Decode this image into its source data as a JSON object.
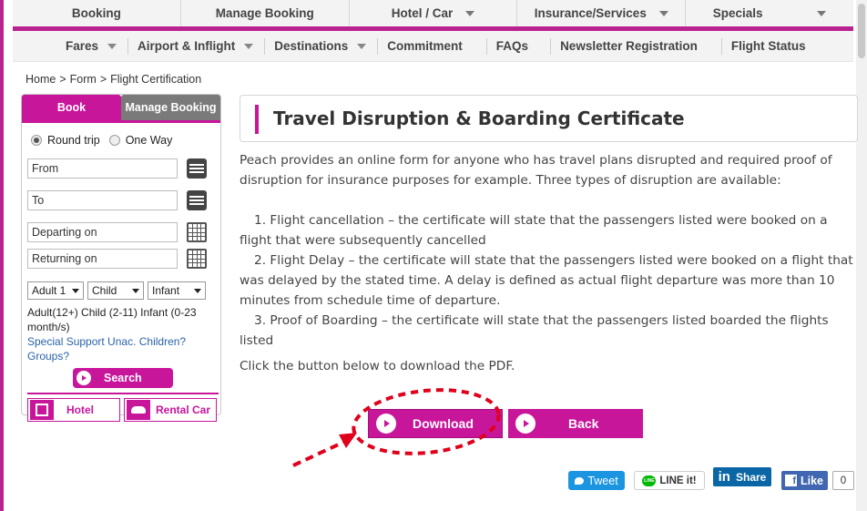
{
  "topnav": [
    {
      "label": "Booking",
      "dropdown": false
    },
    {
      "label": "Manage Booking",
      "dropdown": false
    },
    {
      "label": "Hotel / Car",
      "dropdown": true
    },
    {
      "label": "Insurance/Services",
      "dropdown": true
    },
    {
      "label": "Specials",
      "dropdown": true
    }
  ],
  "subnav": [
    {
      "label": "Fares",
      "dropdown": true
    },
    {
      "label": "Airport & Inflight",
      "dropdown": true
    },
    {
      "label": "Destinations",
      "dropdown": true
    },
    {
      "label": "Commitment",
      "dropdown": false
    },
    {
      "label": "FAQs",
      "dropdown": false
    },
    {
      "label": "Newsletter Registration",
      "dropdown": false
    },
    {
      "label": "Flight Status",
      "dropdown": false
    }
  ],
  "breadcrumb": [
    "Home",
    ">",
    "Form",
    ">",
    "Flight Certification"
  ],
  "widget": {
    "tab_book": "Book",
    "tab_manage": "Manage Booking",
    "round_trip": "Round trip",
    "one_way": "One Way",
    "from_value": "From",
    "to_value": "To",
    "departing_value": "Departing on",
    "returning_value": "Returning on",
    "adult_select": "Adult 1",
    "child_select": "Child",
    "infant_select": "Infant",
    "pax_note": "Adult(12+) Child (2-11) Infant (0-23 month/s)",
    "link_unac": "Special Support Unac. Children?",
    "link_groups": "Groups?",
    "search_label": "Search",
    "hotel_label": "Hotel",
    "car_label": "Rental Car"
  },
  "main": {
    "title": "Travel Disruption & Boarding Certificate",
    "intro": "Peach provides an online form for anyone who has travel plans disrupted and required proof of disruption for insurance purposes for example. Three types of disruption are available:",
    "items": [
      "1. Flight cancellation – the certificate will state that the passengers listed were booked on a flight that were subsequently cancelled",
      "2. Flight Delay – the certificate will state that the passengers listed were booked on a flight that was delayed by the stated time. A delay is defined as actual flight departure was more than 10 minutes from schedule time of departure.",
      "3. Proof of Boarding – the certificate will state that the passengers listed boarded the flights listed"
    ],
    "click_note": "Click the button below to download the PDF.",
    "download_label": "Download",
    "back_label": "Back"
  },
  "social": {
    "tweet": "Tweet",
    "line": "LINE it!",
    "share": "Share",
    "like": "Like",
    "like_count": "0"
  },
  "colors": {
    "brand": "#c8169b",
    "annotation": "#e0001b"
  }
}
